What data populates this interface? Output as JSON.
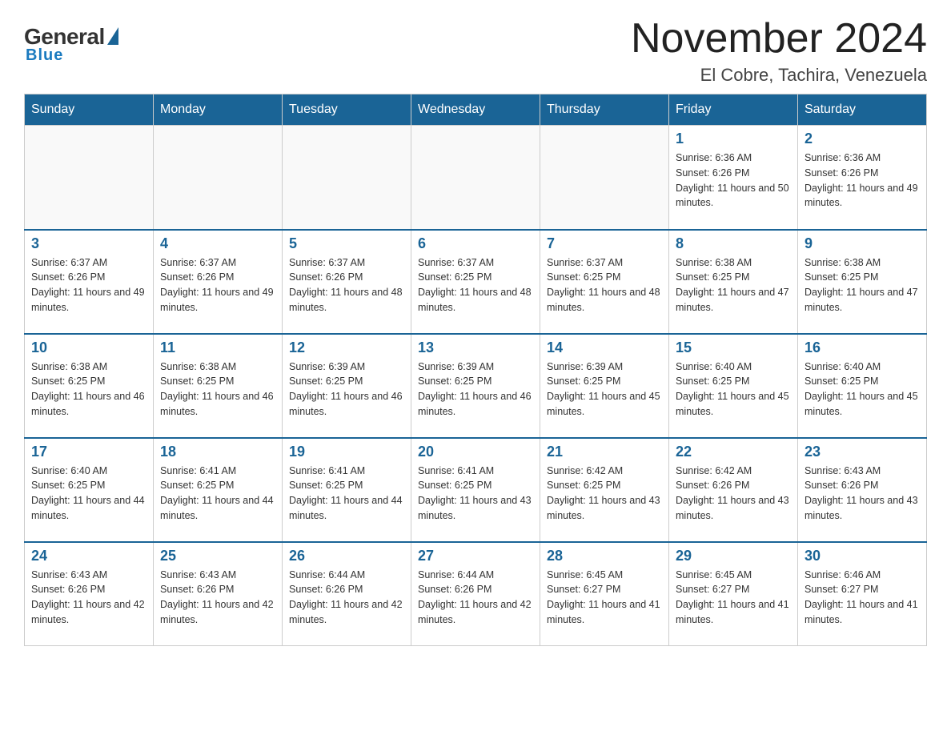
{
  "header": {
    "logo": {
      "general": "General",
      "blue": "Blue",
      "underline": "Blue"
    },
    "title": "November 2024",
    "location": "El Cobre, Tachira, Venezuela"
  },
  "days_of_week": [
    "Sunday",
    "Monday",
    "Tuesday",
    "Wednesday",
    "Thursday",
    "Friday",
    "Saturday"
  ],
  "weeks": [
    [
      {
        "day": "",
        "info": ""
      },
      {
        "day": "",
        "info": ""
      },
      {
        "day": "",
        "info": ""
      },
      {
        "day": "",
        "info": ""
      },
      {
        "day": "",
        "info": ""
      },
      {
        "day": "1",
        "info": "Sunrise: 6:36 AM\nSunset: 6:26 PM\nDaylight: 11 hours and 50 minutes."
      },
      {
        "day": "2",
        "info": "Sunrise: 6:36 AM\nSunset: 6:26 PM\nDaylight: 11 hours and 49 minutes."
      }
    ],
    [
      {
        "day": "3",
        "info": "Sunrise: 6:37 AM\nSunset: 6:26 PM\nDaylight: 11 hours and 49 minutes."
      },
      {
        "day": "4",
        "info": "Sunrise: 6:37 AM\nSunset: 6:26 PM\nDaylight: 11 hours and 49 minutes."
      },
      {
        "day": "5",
        "info": "Sunrise: 6:37 AM\nSunset: 6:26 PM\nDaylight: 11 hours and 48 minutes."
      },
      {
        "day": "6",
        "info": "Sunrise: 6:37 AM\nSunset: 6:25 PM\nDaylight: 11 hours and 48 minutes."
      },
      {
        "day": "7",
        "info": "Sunrise: 6:37 AM\nSunset: 6:25 PM\nDaylight: 11 hours and 48 minutes."
      },
      {
        "day": "8",
        "info": "Sunrise: 6:38 AM\nSunset: 6:25 PM\nDaylight: 11 hours and 47 minutes."
      },
      {
        "day": "9",
        "info": "Sunrise: 6:38 AM\nSunset: 6:25 PM\nDaylight: 11 hours and 47 minutes."
      }
    ],
    [
      {
        "day": "10",
        "info": "Sunrise: 6:38 AM\nSunset: 6:25 PM\nDaylight: 11 hours and 46 minutes."
      },
      {
        "day": "11",
        "info": "Sunrise: 6:38 AM\nSunset: 6:25 PM\nDaylight: 11 hours and 46 minutes."
      },
      {
        "day": "12",
        "info": "Sunrise: 6:39 AM\nSunset: 6:25 PM\nDaylight: 11 hours and 46 minutes."
      },
      {
        "day": "13",
        "info": "Sunrise: 6:39 AM\nSunset: 6:25 PM\nDaylight: 11 hours and 46 minutes."
      },
      {
        "day": "14",
        "info": "Sunrise: 6:39 AM\nSunset: 6:25 PM\nDaylight: 11 hours and 45 minutes."
      },
      {
        "day": "15",
        "info": "Sunrise: 6:40 AM\nSunset: 6:25 PM\nDaylight: 11 hours and 45 minutes."
      },
      {
        "day": "16",
        "info": "Sunrise: 6:40 AM\nSunset: 6:25 PM\nDaylight: 11 hours and 45 minutes."
      }
    ],
    [
      {
        "day": "17",
        "info": "Sunrise: 6:40 AM\nSunset: 6:25 PM\nDaylight: 11 hours and 44 minutes."
      },
      {
        "day": "18",
        "info": "Sunrise: 6:41 AM\nSunset: 6:25 PM\nDaylight: 11 hours and 44 minutes."
      },
      {
        "day": "19",
        "info": "Sunrise: 6:41 AM\nSunset: 6:25 PM\nDaylight: 11 hours and 44 minutes."
      },
      {
        "day": "20",
        "info": "Sunrise: 6:41 AM\nSunset: 6:25 PM\nDaylight: 11 hours and 43 minutes."
      },
      {
        "day": "21",
        "info": "Sunrise: 6:42 AM\nSunset: 6:25 PM\nDaylight: 11 hours and 43 minutes."
      },
      {
        "day": "22",
        "info": "Sunrise: 6:42 AM\nSunset: 6:26 PM\nDaylight: 11 hours and 43 minutes."
      },
      {
        "day": "23",
        "info": "Sunrise: 6:43 AM\nSunset: 6:26 PM\nDaylight: 11 hours and 43 minutes."
      }
    ],
    [
      {
        "day": "24",
        "info": "Sunrise: 6:43 AM\nSunset: 6:26 PM\nDaylight: 11 hours and 42 minutes."
      },
      {
        "day": "25",
        "info": "Sunrise: 6:43 AM\nSunset: 6:26 PM\nDaylight: 11 hours and 42 minutes."
      },
      {
        "day": "26",
        "info": "Sunrise: 6:44 AM\nSunset: 6:26 PM\nDaylight: 11 hours and 42 minutes."
      },
      {
        "day": "27",
        "info": "Sunrise: 6:44 AM\nSunset: 6:26 PM\nDaylight: 11 hours and 42 minutes."
      },
      {
        "day": "28",
        "info": "Sunrise: 6:45 AM\nSunset: 6:27 PM\nDaylight: 11 hours and 41 minutes."
      },
      {
        "day": "29",
        "info": "Sunrise: 6:45 AM\nSunset: 6:27 PM\nDaylight: 11 hours and 41 minutes."
      },
      {
        "day": "30",
        "info": "Sunrise: 6:46 AM\nSunset: 6:27 PM\nDaylight: 11 hours and 41 minutes."
      }
    ]
  ]
}
